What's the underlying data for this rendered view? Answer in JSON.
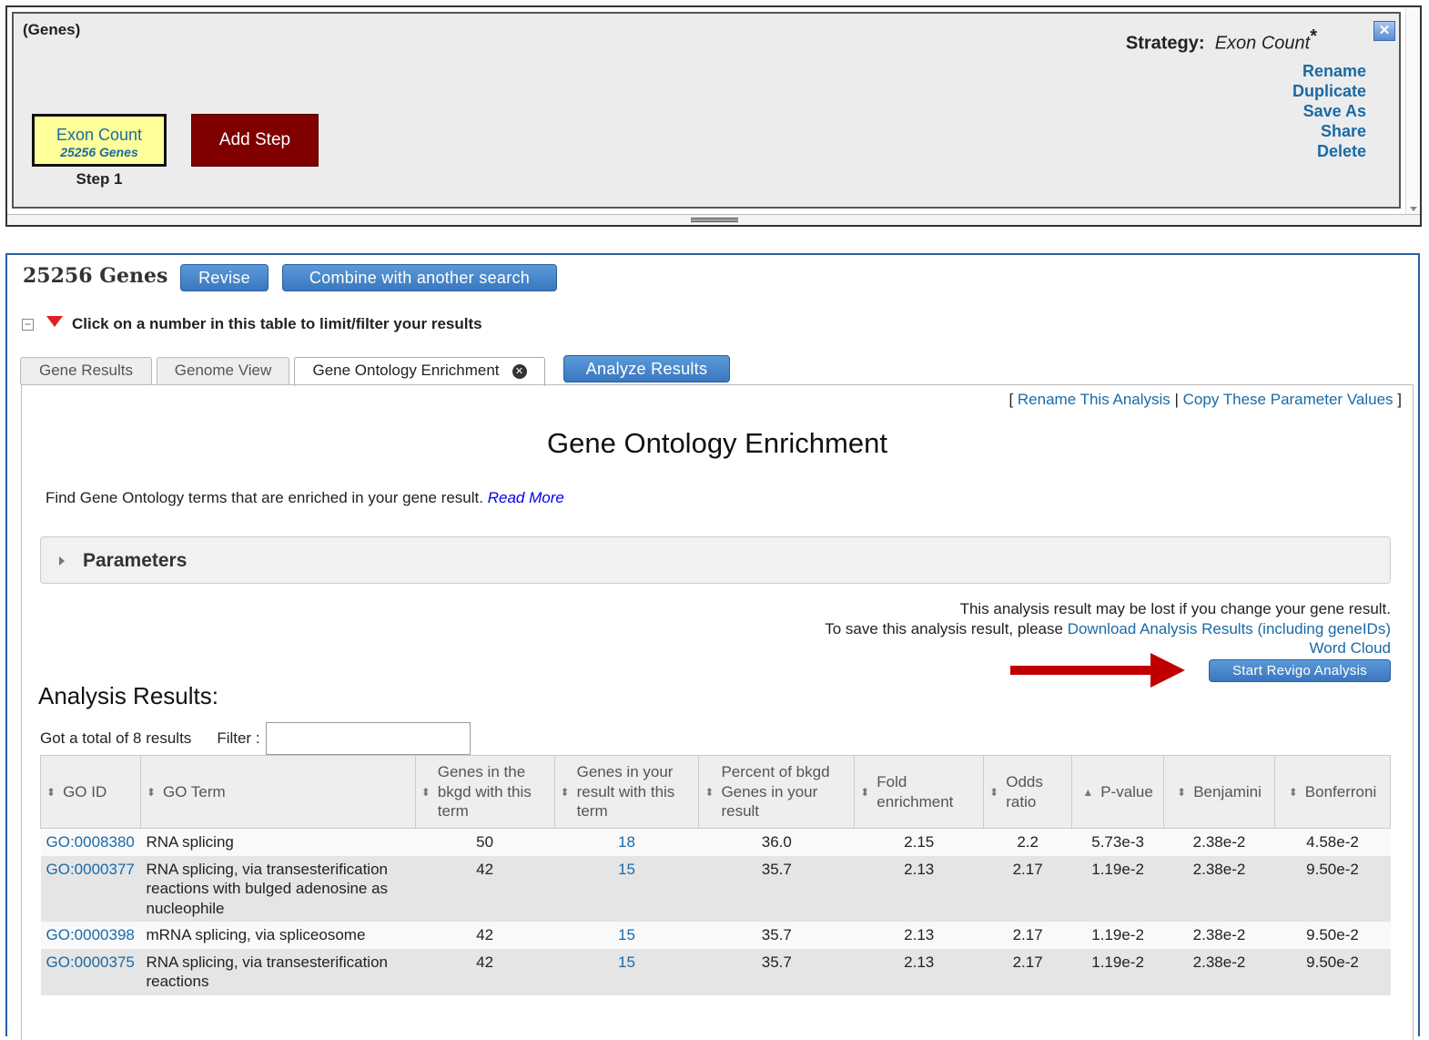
{
  "strategy": {
    "record_type": "(Genes)",
    "step": {
      "name": "Exon Count",
      "count": "25256 Genes",
      "label": "Step 1"
    },
    "add_step_label": "Add Step",
    "strategy_label": "Strategy:",
    "strategy_name": "Exon Count",
    "unsaved_marker": "*",
    "close_glyph": "✕",
    "actions": [
      "Rename",
      "Duplicate",
      "Save As",
      "Share",
      "Delete"
    ]
  },
  "results": {
    "count_label": "25256 Genes",
    "revise_label": "Revise",
    "combine_label": "Combine with another search",
    "filter_prompt": "Click on a number in this table to limit/filter your results",
    "tabs": [
      "Gene Results",
      "Genome View",
      "Gene Ontology Enrichment"
    ],
    "analyze_label": "Analyze Results"
  },
  "analysis": {
    "rename_link": "Rename This Analysis",
    "copy_link": "Copy These Parameter Values",
    "title": "Gene Ontology Enrichment",
    "intro": "Find Gene Ontology terms that are enriched in your gene result.",
    "read_more": "Read More",
    "parameters_label": "Parameters",
    "note_line1": "This analysis result may be lost if you change your gene result.",
    "note_line2_prefix": "To save this analysis result, please",
    "download_link": "Download Analysis Results (including geneIDs)",
    "word_cloud_link": "Word Cloud",
    "revigo_label": "Start Revigo Analysis",
    "results_title": "Analysis Results:",
    "total_text": "Got a total of 8 results",
    "filter_label": "Filter :",
    "filter_value": ""
  },
  "table": {
    "columns": [
      "GO ID",
      "GO Term",
      "Genes in the bkgd with this term",
      "Genes in your result with this term",
      "Percent of bkgd Genes in your result",
      "Fold enrichment",
      "Odds ratio",
      "P-value",
      "Benjamini",
      "Bonferroni"
    ],
    "rows": [
      [
        "GO:0008380",
        "RNA splicing",
        "50",
        "18",
        "36.0",
        "2.15",
        "2.2",
        "5.73e-3",
        "2.38e-2",
        "4.58e-2"
      ],
      [
        "GO:0000377",
        "RNA splicing, via transesterification reactions with bulged adenosine as nucleophile",
        "42",
        "15",
        "35.7",
        "2.13",
        "2.17",
        "1.19e-2",
        "2.38e-2",
        "9.50e-2"
      ],
      [
        "GO:0000398",
        "mRNA splicing, via spliceosome",
        "42",
        "15",
        "35.7",
        "2.13",
        "2.17",
        "1.19e-2",
        "2.38e-2",
        "9.50e-2"
      ],
      [
        "GO:0000375",
        "RNA splicing, via transesterification reactions",
        "42",
        "15",
        "35.7",
        "2.13",
        "2.17",
        "1.19e-2",
        "2.38e-2",
        "9.50e-2"
      ]
    ]
  },
  "colors": {
    "link": "#1a6aa6",
    "add_step": "#800000",
    "step_box": "#ffff99",
    "button": "#3a77bf",
    "arrow": "#c00000"
  }
}
